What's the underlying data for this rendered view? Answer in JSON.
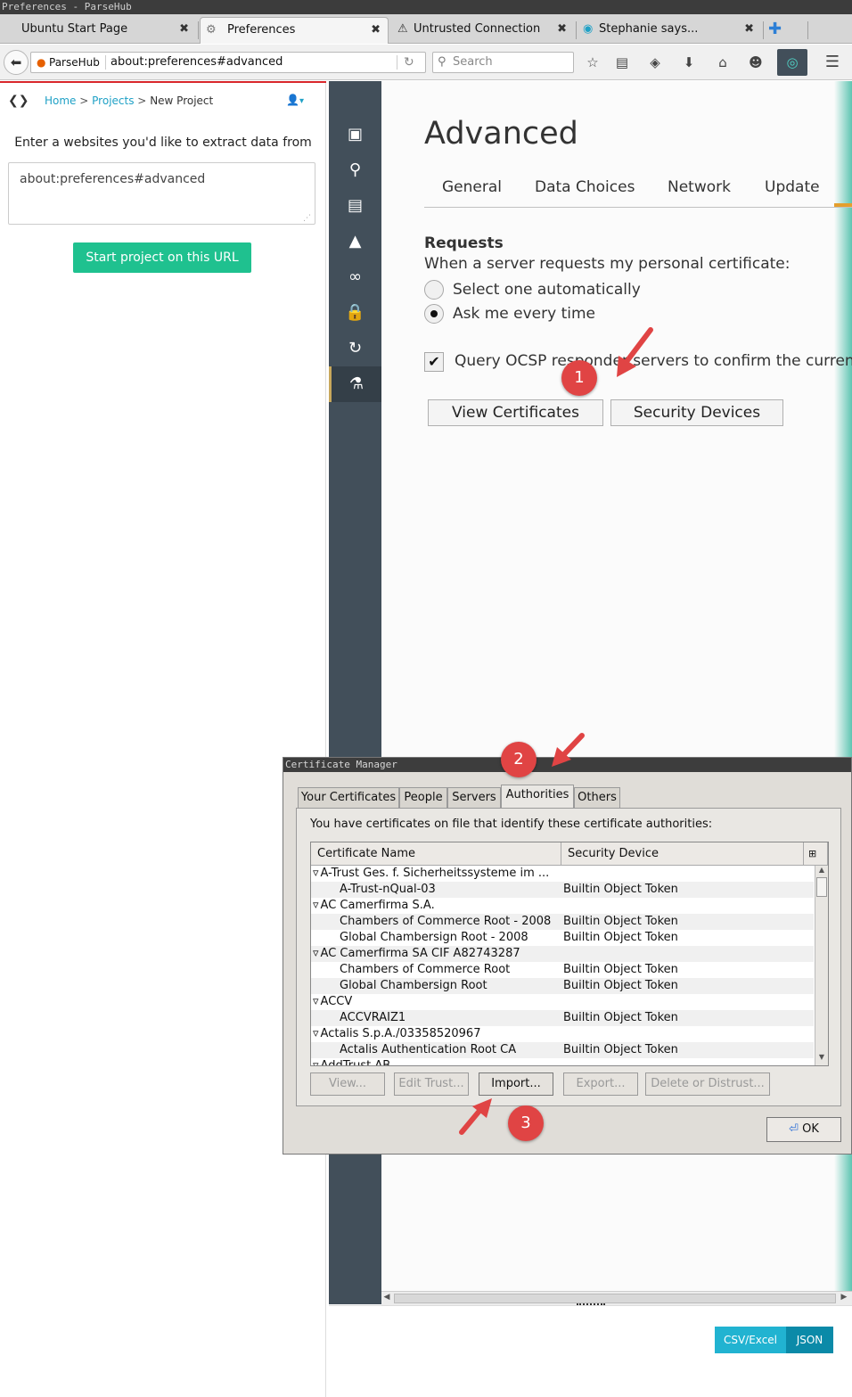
{
  "window": {
    "title": "Preferences - ParseHub"
  },
  "tabs": [
    {
      "label": "Ubuntu Start Page",
      "icon": "none"
    },
    {
      "label": "Preferences",
      "icon": "gear-icon"
    },
    {
      "label": "Untrusted Connection",
      "icon": "warning-icon"
    },
    {
      "label": "Stephanie says...",
      "icon": "parsehub-icon"
    }
  ],
  "navbar": {
    "identity_label": "ParseHub",
    "url": "about:preferences#advanced",
    "search_placeholder": "Search"
  },
  "parsehub": {
    "breadcrumb_home": "Home",
    "breadcrumb_sep1": ">",
    "breadcrumb_projects": "Projects",
    "breadcrumb_sep2": ">",
    "breadcrumb_current": "New Project",
    "prompt": "Enter a websites you'd like to extract data from",
    "url_value": "about:preferences#advanced",
    "start_button": "Start project on this URL",
    "export_csv": "CSV/Excel",
    "export_json": "JSON"
  },
  "prefs": {
    "heading": "Advanced",
    "tabs": [
      "General",
      "Data Choices",
      "Network",
      "Update"
    ],
    "requests_title": "Requests",
    "requests_desc": "When a server requests my personal certificate:",
    "radio_auto": "Select one automatically",
    "radio_ask": "Ask me every time",
    "selected_radio": "Ask me every time",
    "ocsp_label": "Query OCSP responder servers to confirm the curren",
    "ocsp_checked": true,
    "view_certs_button": "View Certificates",
    "security_devices_button": "Security Devices"
  },
  "markers": [
    "1",
    "2",
    "3"
  ],
  "cert_manager": {
    "title": "Certificate Manager",
    "tabs": [
      "Your Certificates",
      "People",
      "Servers",
      "Authorities",
      "Others"
    ],
    "active_tab": "Authorities",
    "description": "You have certificates on file that identify these certificate authorities:",
    "col_name": "Certificate Name",
    "col_device": "Security Device",
    "rows": [
      {
        "name": "A-Trust Ges. f. Sicherheitssysteme im ...",
        "device": "",
        "group": true
      },
      {
        "name": "A-Trust-nQual-03",
        "device": "Builtin Object Token",
        "group": false
      },
      {
        "name": "AC Camerfirma S.A.",
        "device": "",
        "group": true
      },
      {
        "name": "Chambers of Commerce Root - 2008",
        "device": "Builtin Object Token",
        "group": false
      },
      {
        "name": "Global Chambersign Root - 2008",
        "device": "Builtin Object Token",
        "group": false
      },
      {
        "name": "AC Camerfirma SA CIF A82743287",
        "device": "",
        "group": true
      },
      {
        "name": "Chambers of Commerce Root",
        "device": "Builtin Object Token",
        "group": false
      },
      {
        "name": "Global Chambersign Root",
        "device": "Builtin Object Token",
        "group": false
      },
      {
        "name": "ACCV",
        "device": "",
        "group": true
      },
      {
        "name": "ACCVRAIZ1",
        "device": "Builtin Object Token",
        "group": false
      },
      {
        "name": "Actalis S.p.A./03358520967",
        "device": "",
        "group": true
      },
      {
        "name": "Actalis Authentication Root CA",
        "device": "Builtin Object Token",
        "group": false
      },
      {
        "name": "AddTrust AB",
        "device": "",
        "group": true
      }
    ],
    "buttons": [
      "View...",
      "Edit Trust...",
      "Import...",
      "Export...",
      "Delete or Distrust..."
    ],
    "ok_button": "OK"
  },
  "colors": {
    "accent_green": "#1fc18f",
    "link_blue": "#1fa1c6",
    "pref_sidebar": "#424f5a",
    "marker_red": "#e04444"
  }
}
